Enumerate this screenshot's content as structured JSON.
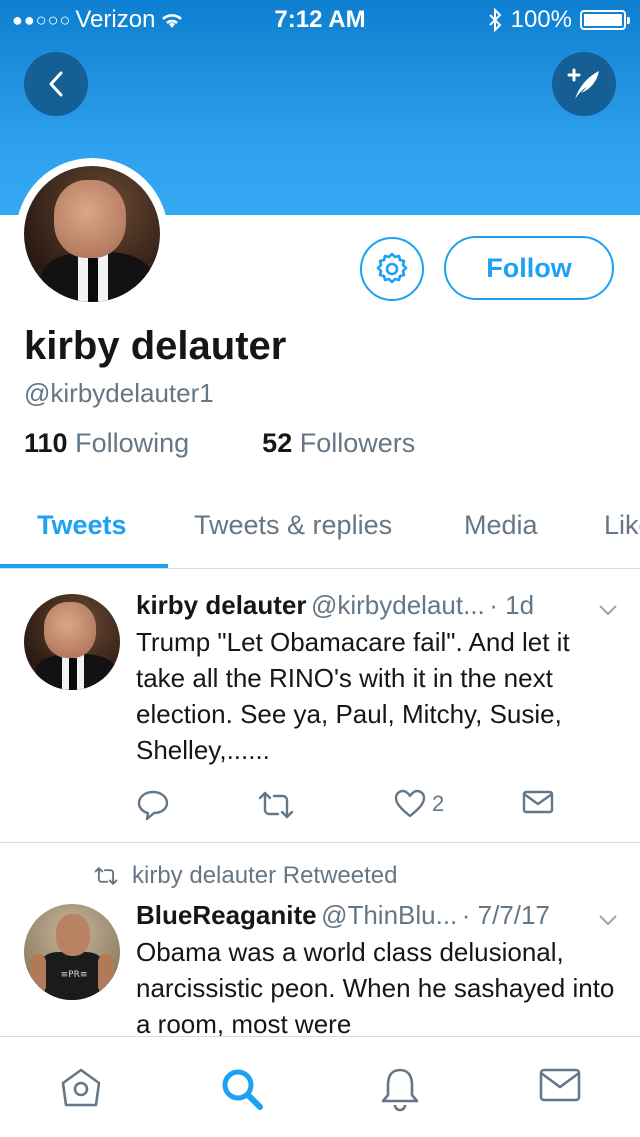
{
  "status_bar": {
    "carrier": "Verizon",
    "time": "7:12 AM",
    "battery": "100%",
    "signal_dots": "●●○○○"
  },
  "profile": {
    "name": "kirby delauter",
    "handle": "@kirbydelauter1",
    "following_count": "110",
    "following_label": "Following",
    "followers_count": "52",
    "followers_label": "Followers",
    "follow_button": "Follow"
  },
  "tabs": [
    {
      "label": "Tweets",
      "active": true
    },
    {
      "label": "Tweets & replies",
      "active": false
    },
    {
      "label": "Media",
      "active": false
    },
    {
      "label": "Likes",
      "active": false
    }
  ],
  "tweets": [
    {
      "name": "kirby delauter",
      "handle": "@kirbydelaut...",
      "time": "· 1d",
      "body": "Trump \"Let Obamacare fail\". And let it take all the RINO's with it in the next election.  See ya, Paul, Mitchy, Susie, Shelley,......",
      "likes": "2"
    },
    {
      "retweet_label": "kirby delauter Retweeted",
      "name": "BlueReaganite",
      "handle": "@ThinBlu...",
      "time": "· 7/7/17",
      "body": "Obama was a world class delusional, narcissistic peon. When he sashayed into a room, most were",
      "avatar_text": "≡PR≡"
    }
  ],
  "colors": {
    "accent": "#1da1f2",
    "banner_top": "#0e7fd0",
    "banner_bottom": "#35a8f2",
    "secondary_text": "#657786"
  },
  "icons": {
    "back": "chevron-left-icon",
    "compose": "compose-tweet-icon",
    "settings": "gear-icon",
    "reply": "reply-icon",
    "retweet": "retweet-icon",
    "like": "heart-icon",
    "dm": "envelope-icon",
    "tabbar": [
      "home-icon",
      "search-icon",
      "notifications-icon",
      "messages-icon"
    ]
  }
}
